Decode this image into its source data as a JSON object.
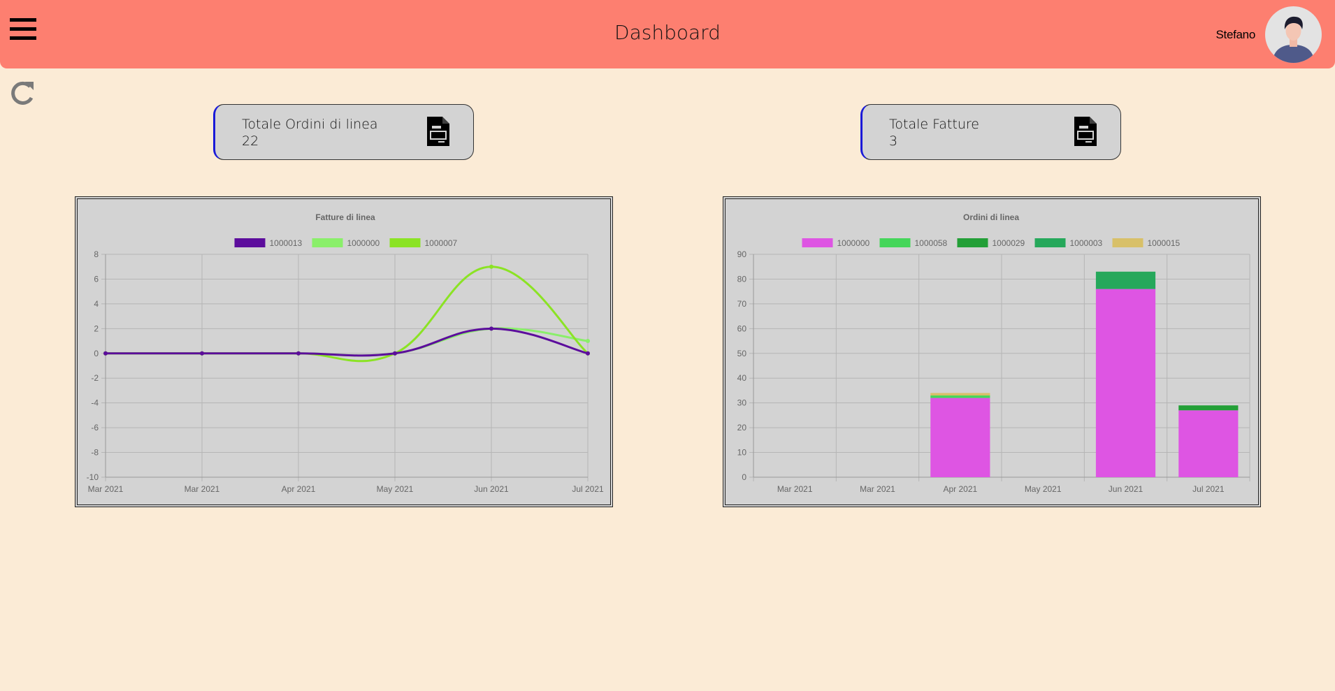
{
  "header": {
    "title": "Dashboard",
    "user_name": "Stefano",
    "menu_icon": "hamburger-menu-icon",
    "avatar_icon": "user-avatar"
  },
  "toolbar": {
    "refresh_icon": "refresh-icon"
  },
  "cards": [
    {
      "label": "Totale Ordini di linea",
      "value": "22",
      "icon": "document-icon"
    },
    {
      "label": "Totale Fatture",
      "value": "3",
      "icon": "document-icon"
    }
  ],
  "colors": {
    "header": "#fd7f70",
    "background": "#fbebd6",
    "panel": "#d3d3d3",
    "card_accent": "#1a1ad8"
  },
  "chart_data": [
    {
      "type": "line",
      "title": "Fatture di linea",
      "categories": [
        "Mar 2021",
        "Mar 2021",
        "Apr 2021",
        "May 2021",
        "Jun 2021",
        "Jul 2021"
      ],
      "ylim": [
        -10,
        8
      ],
      "yticks": [
        "8",
        "6",
        "4",
        "2",
        "0",
        "-2",
        "-4",
        "-6",
        "-8",
        "-10"
      ],
      "grid": true,
      "legend_position": "top",
      "series": [
        {
          "name": "1000013",
          "color": "#5c0d9c",
          "values": [
            0,
            0,
            0,
            0,
            2,
            0
          ]
        },
        {
          "name": "1000000",
          "color": "#8aef6a",
          "values": [
            0,
            0,
            0,
            0,
            2,
            1
          ]
        },
        {
          "name": "1000007",
          "color": "#8be324",
          "values": [
            0,
            0,
            0,
            0,
            7,
            0
          ]
        }
      ]
    },
    {
      "type": "bar",
      "stacked": true,
      "title": "Ordini di linea",
      "categories": [
        "Mar 2021",
        "Mar 2021",
        "Apr 2021",
        "May 2021",
        "Jun 2021",
        "Jul 2021"
      ],
      "ylim": [
        0,
        90
      ],
      "yticks": [
        "90",
        "80",
        "70",
        "60",
        "50",
        "40",
        "30",
        "20",
        "10",
        "0"
      ],
      "grid": true,
      "legend_position": "top",
      "series": [
        {
          "name": "1000000",
          "color": "#de55e3",
          "values": [
            0,
            0,
            32,
            0,
            76,
            27
          ]
        },
        {
          "name": "1000058",
          "color": "#45d65a",
          "values": [
            0,
            0,
            1,
            0,
            0,
            0
          ]
        },
        {
          "name": "1000029",
          "color": "#239f37",
          "values": [
            0,
            0,
            0,
            0,
            0,
            2
          ]
        },
        {
          "name": "1000003",
          "color": "#26a85b",
          "values": [
            0,
            0,
            0,
            0,
            7,
            0
          ]
        },
        {
          "name": "1000015",
          "color": "#d8c069",
          "values": [
            0,
            0,
            1,
            0,
            0,
            0
          ]
        }
      ]
    }
  ]
}
